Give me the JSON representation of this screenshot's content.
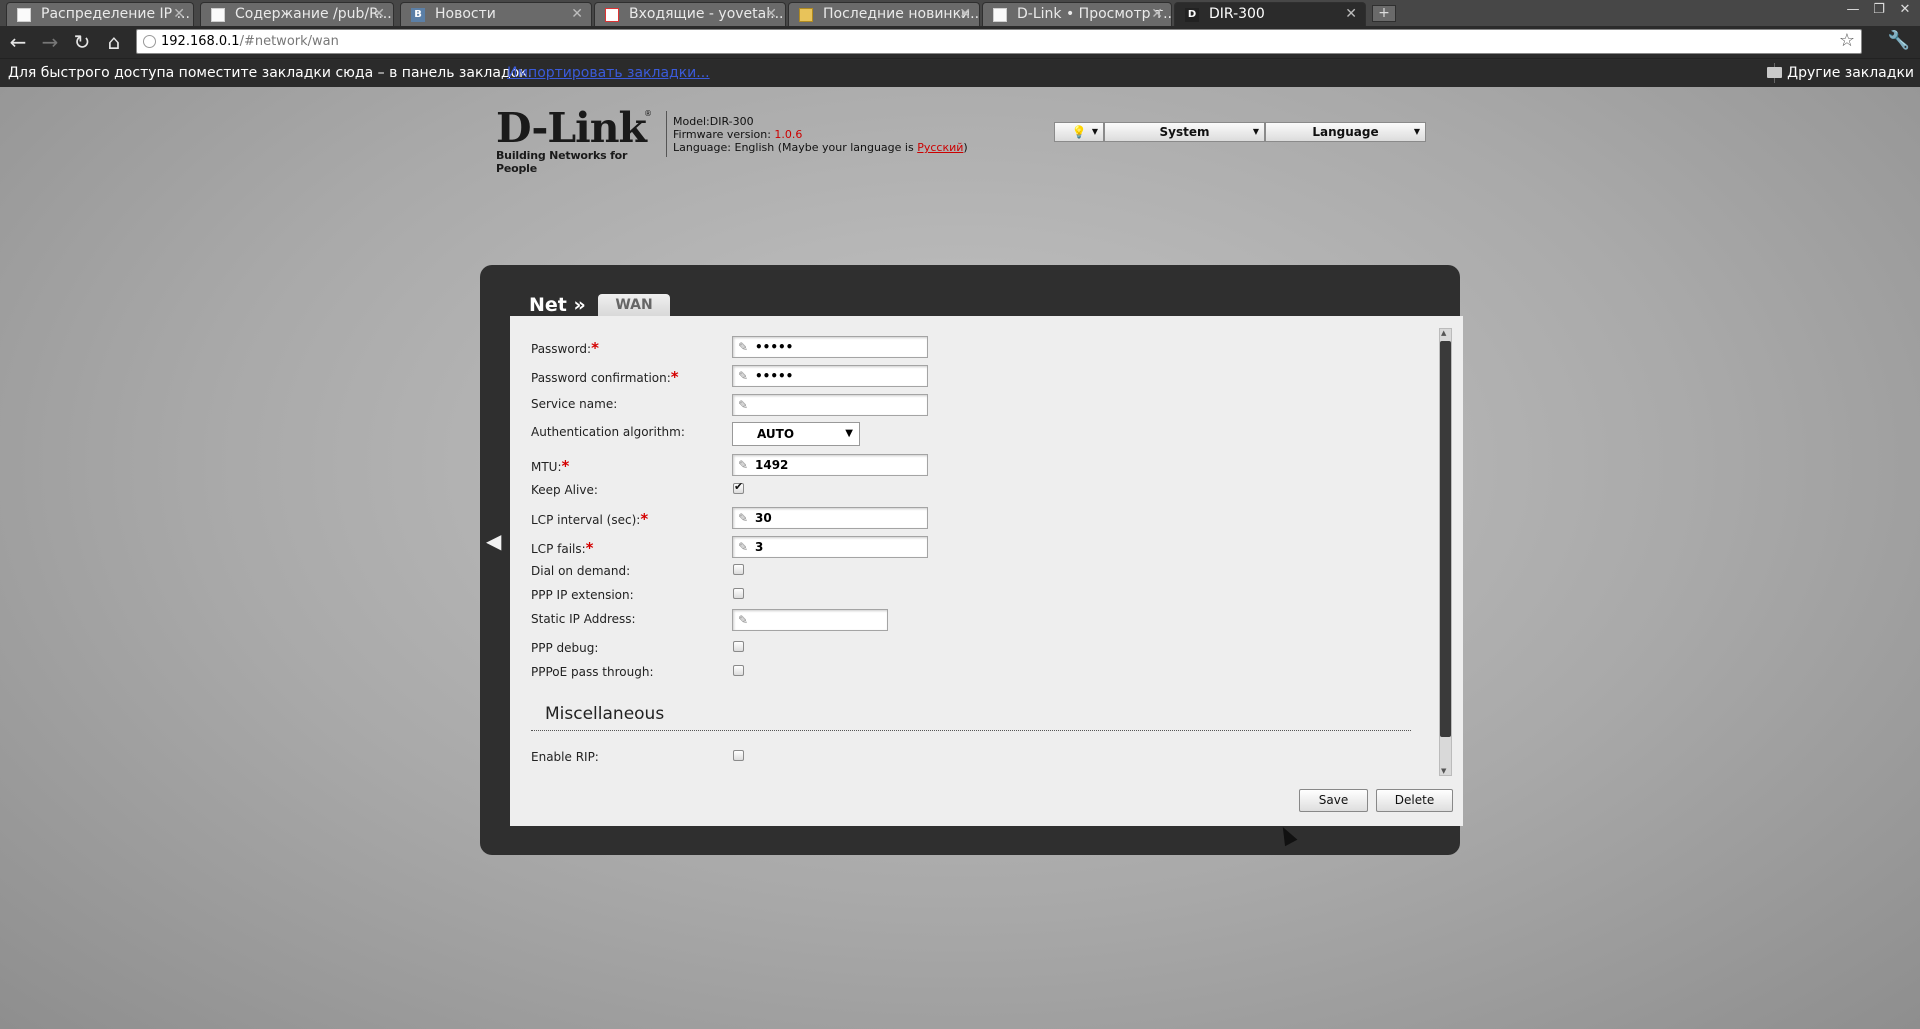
{
  "browser": {
    "tabs": [
      {
        "title": "Распределение IP ...",
        "icon": "page-icon"
      },
      {
        "title": "Содержание /pub/R...",
        "icon": "page-icon"
      },
      {
        "title": "Новости",
        "icon": "vk-icon"
      },
      {
        "title": "Входящие - yovetal...",
        "icon": "gmail-icon"
      },
      {
        "title": "Последние новинки...",
        "icon": "yandex-icon"
      },
      {
        "title": "D-Link • Просмотр т...",
        "icon": "page-icon"
      },
      {
        "title": "DIR-300",
        "icon": "dlink-icon"
      }
    ],
    "url_host": "192.168.0.1",
    "url_path": "/#network/wan",
    "bookmarks_hint": "Для быстрого доступа поместите закладки сюда – в панель закладок.",
    "bookmarks_import": "Импортировать закладки...",
    "other_bookmarks": "Другие закладки"
  },
  "header": {
    "logo": "D-Link",
    "logo_reg": "®",
    "tagline": "Building Networks for People",
    "model": "Model:DIR-300",
    "firmware_label": "Firmware version: ",
    "firmware_version": "1.0.6",
    "language_text": "Language: English (Maybe your language is ",
    "language_link": "Русский",
    "language_close": ")"
  },
  "topmenu": {
    "system": "System",
    "language": "Language"
  },
  "panel": {
    "crumb": "Net »",
    "tab": "WAN"
  },
  "form": {
    "password_label": "Password:",
    "password_value": "•••••",
    "password_confirm_label": "Password confirmation:",
    "password_confirm_value": "•••••",
    "service_name_label": "Service name:",
    "service_name_value": "",
    "auth_label": "Authentication algorithm:",
    "auth_value": "AUTO",
    "mtu_label": "MTU:",
    "mtu_value": "1492",
    "keep_alive_label": "Keep Alive:",
    "keep_alive_checked": true,
    "lcp_interval_label": "LCP interval (sec):",
    "lcp_interval_value": "30",
    "lcp_fails_label": "LCP fails:",
    "lcp_fails_value": "3",
    "dial_on_demand_label": "Dial on demand:",
    "ppp_ip_extension_label": "PPP IP extension:",
    "static_ip_label": "Static IP Address:",
    "static_ip_value": "",
    "ppp_debug_label": "PPP debug:",
    "pppoe_pass_label": "PPPoE pass through:",
    "misc_title": "Miscellaneous",
    "enable_rip_label": "Enable RIP:",
    "required_mark": "*"
  },
  "actions": {
    "save": "Save",
    "delete": "Delete"
  }
}
